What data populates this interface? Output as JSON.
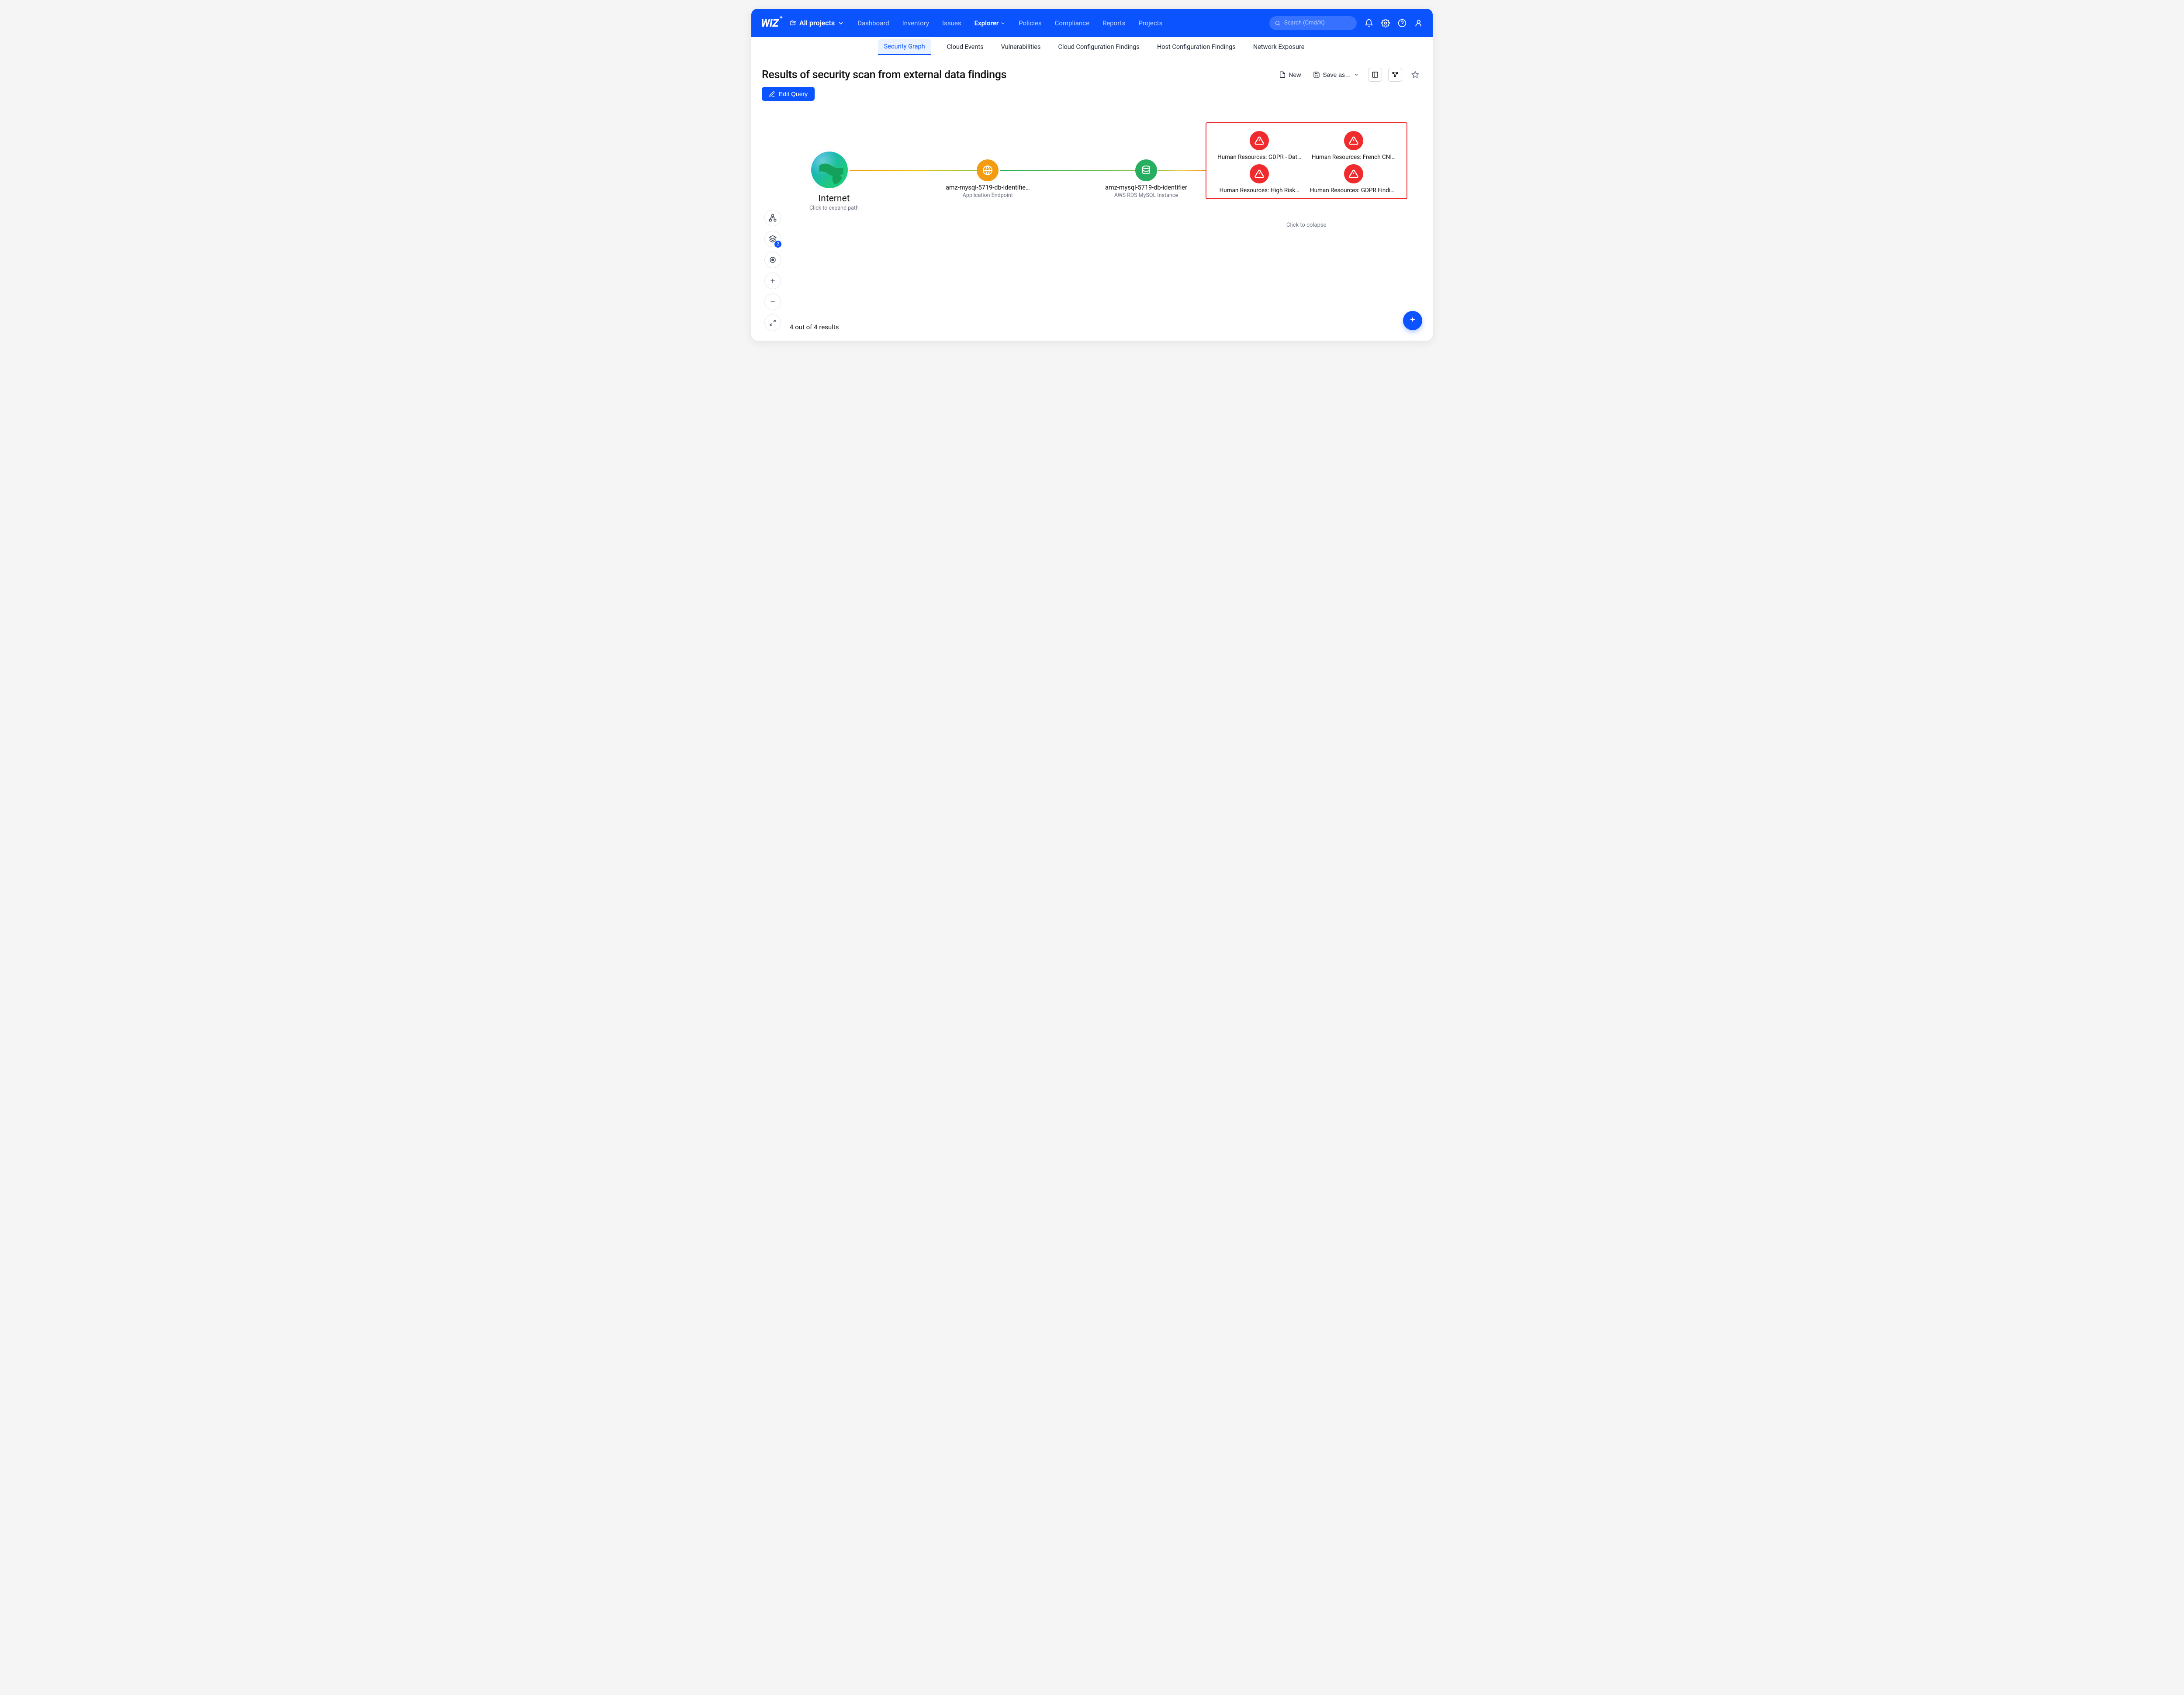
{
  "brand": "WIZ",
  "project_picker": "All projects",
  "nav": [
    "Dashboard",
    "Inventory",
    "Issues",
    "Explorer",
    "Policies",
    "Compliance",
    "Reports",
    "Projects"
  ],
  "nav_active": "Explorer",
  "search_placeholder": "Search (Cmd/K)",
  "subnav": [
    "Security Graph",
    "Cloud Events",
    "Vulnerabilities",
    "Cloud Configuration Findings",
    "Host Configuration Findings",
    "Network Exposure"
  ],
  "subnav_active": "Security Graph",
  "page_title": "Results of security scan from external data findings",
  "actions": {
    "new": "New",
    "save_as": "Save as…"
  },
  "edit_query": "Edit Query",
  "layers_badge": "2",
  "results_count": "4 out of 4 results",
  "graph": {
    "internet": {
      "title": "Internet",
      "hint": "Click to expand path"
    },
    "endpoint": {
      "title": "amz-mysql-5719-db-identifie…",
      "sub": "Application Endpoint"
    },
    "database": {
      "title": "amz-mysql-5719-db-identifier",
      "sub": "AWS RDS MySQL Instance"
    },
    "findings": [
      "Human Resources: GDPR - Dat…",
      "Human Resources: French CNI…",
      "Human Resources: High Risk…",
      "Human Resources: GDPR Findings"
    ],
    "collapse_hint": "Click to colapse"
  }
}
